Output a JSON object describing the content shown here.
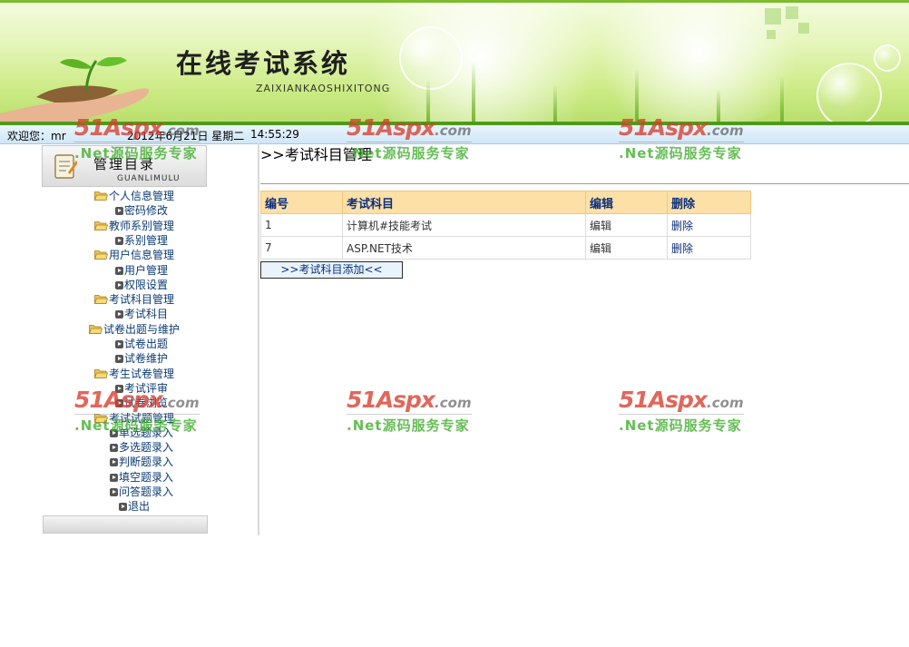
{
  "header": {
    "title": "在线考试系统",
    "subtitle": "ZAIXIANKAOSHIXITONG"
  },
  "status": {
    "welcome": "欢迎您：mr",
    "date": "2012年6月21日  星期二",
    "time": "14:55:29"
  },
  "menu": {
    "title": "管理目录",
    "subtitle": "GUANLIMULU",
    "items": [
      {
        "label": "个人信息管理",
        "level": 1
      },
      {
        "label": "密码修改",
        "level": 2
      },
      {
        "label": "教师系别管理",
        "level": 1
      },
      {
        "label": "系别管理",
        "level": 2
      },
      {
        "label": "用户信息管理",
        "level": 1
      },
      {
        "label": "用户管理",
        "level": 2
      },
      {
        "label": "权限设置",
        "level": 2
      },
      {
        "label": "考试科目管理",
        "level": 1
      },
      {
        "label": "考试科目",
        "level": 2
      },
      {
        "label": "试卷出题与维护",
        "level": 1
      },
      {
        "label": "试卷出题",
        "level": 2
      },
      {
        "label": "试卷维护",
        "level": 2
      },
      {
        "label": "考生试卷管理",
        "level": 1
      },
      {
        "label": "考试评审",
        "level": 2
      },
      {
        "label": "试卷浏览",
        "level": 2
      },
      {
        "label": "考试试题管理",
        "level": 1
      },
      {
        "label": "单选题录入",
        "level": 2
      },
      {
        "label": "多选题录入",
        "level": 2
      },
      {
        "label": "判断题录入",
        "level": 2
      },
      {
        "label": "填空题录入",
        "level": 2
      },
      {
        "label": "问答题录入",
        "level": 2
      },
      {
        "label": "退出",
        "level": 2
      }
    ]
  },
  "content": {
    "title": ">>考试科目管理",
    "table": {
      "headers": [
        "编号",
        "考试科目",
        "编辑",
        "删除"
      ],
      "rows": [
        [
          "1",
          "计算机#技能考试",
          "编辑",
          "删除"
        ],
        [
          "7",
          "ASP.NET技术",
          "编辑",
          "删除"
        ]
      ]
    },
    "add_button": ">>考试科目添加<<"
  },
  "watermark": {
    "brand": "51Aspx",
    "domain": ".com",
    "slogan": ".Net源码服务专家"
  },
  "colors": {
    "banner_green": "#b7de6a",
    "table_header": "#fde0a6",
    "link_blue": "#0b2f7f",
    "menu_text": "#0b3b74",
    "watermark_red": "#d73c2d",
    "watermark_green": "#3caa28"
  }
}
